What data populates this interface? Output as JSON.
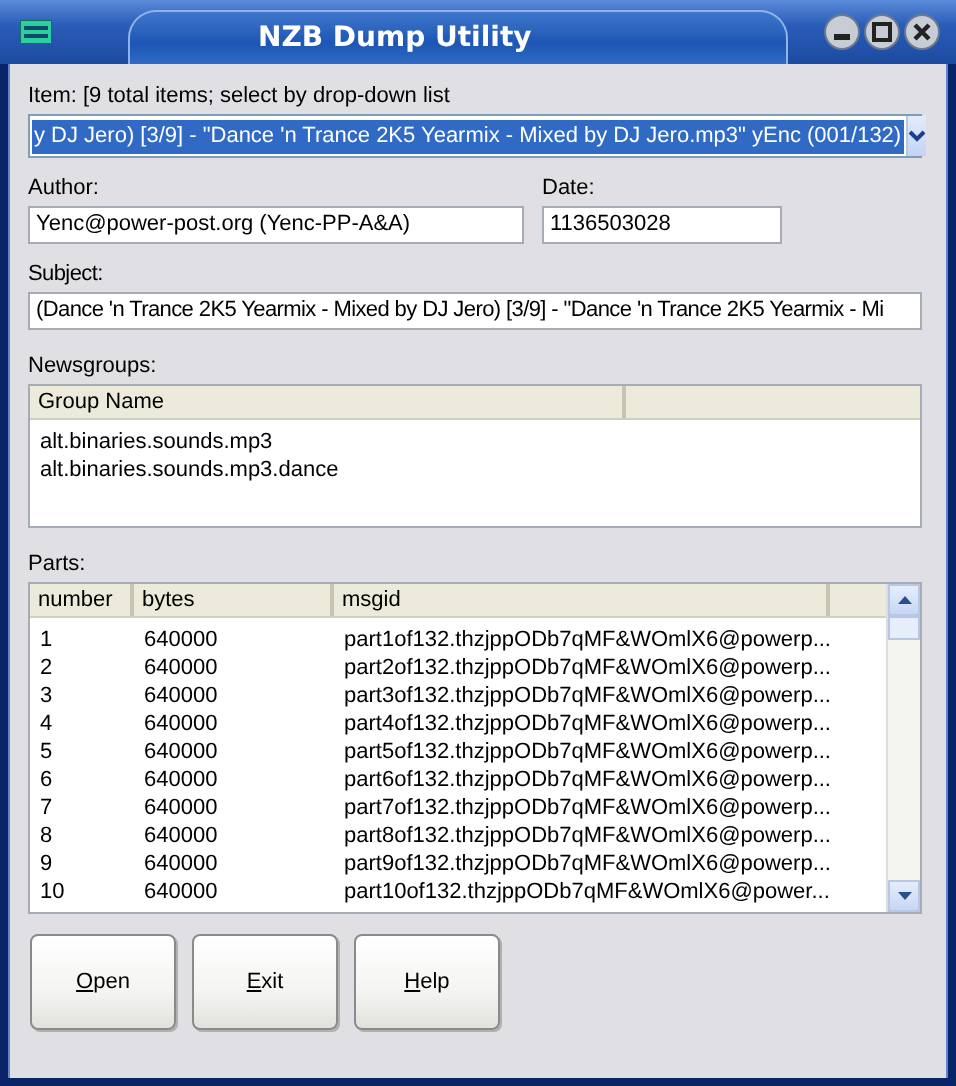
{
  "window": {
    "title": "NZB Dump Utility"
  },
  "item": {
    "label": "Item: [9 total items; select by drop-down list",
    "value": "y DJ Jero) [3/9] - \"Dance 'n Trance 2K5 Yearmix - Mixed by DJ Jero.mp3\" yEnc (001/132)",
    "selected": true
  },
  "author": {
    "label": "Author:",
    "value": "Yenc@power-post.org (Yenc-PP-A&A)"
  },
  "date": {
    "label": "Date:",
    "value": "1136503028"
  },
  "subject": {
    "label": "Subject:",
    "value": "(Dance 'n Trance 2K5 Yearmix - Mixed by DJ Jero) [3/9] - \"Dance 'n Trance 2K5 Yearmix - Mi"
  },
  "newsgroups": {
    "label": "Newsgroups:",
    "columns": [
      "Group Name"
    ],
    "rows": [
      [
        "alt.binaries.sounds.mp3"
      ],
      [
        "alt.binaries.sounds.mp3.dance"
      ]
    ]
  },
  "parts": {
    "label": "Parts:",
    "columns": [
      "number",
      "bytes",
      "msgid"
    ],
    "rows": [
      [
        "1",
        "640000",
        "part1of132.thzjppODb7qMF&WOmlX6@powerp..."
      ],
      [
        "2",
        "640000",
        "part2of132.thzjppODb7qMF&WOmlX6@powerp..."
      ],
      [
        "3",
        "640000",
        "part3of132.thzjppODb7qMF&WOmlX6@powerp..."
      ],
      [
        "4",
        "640000",
        "part4of132.thzjppODb7qMF&WOmlX6@powerp..."
      ],
      [
        "5",
        "640000",
        "part5of132.thzjppODb7qMF&WOmlX6@powerp..."
      ],
      [
        "6",
        "640000",
        "part6of132.thzjppODb7qMF&WOmlX6@powerp..."
      ],
      [
        "7",
        "640000",
        "part7of132.thzjppODb7qMF&WOmlX6@powerp..."
      ],
      [
        "8",
        "640000",
        "part8of132.thzjppODb7qMF&WOmlX6@powerp..."
      ],
      [
        "9",
        "640000",
        "part9of132.thzjppODb7qMF&WOmlX6@powerp..."
      ],
      [
        "10",
        "640000",
        "part10of132.thzjppODb7qMF&WOmlX6@power..."
      ]
    ]
  },
  "buttons": [
    "Open",
    "Exit",
    "Help"
  ]
}
